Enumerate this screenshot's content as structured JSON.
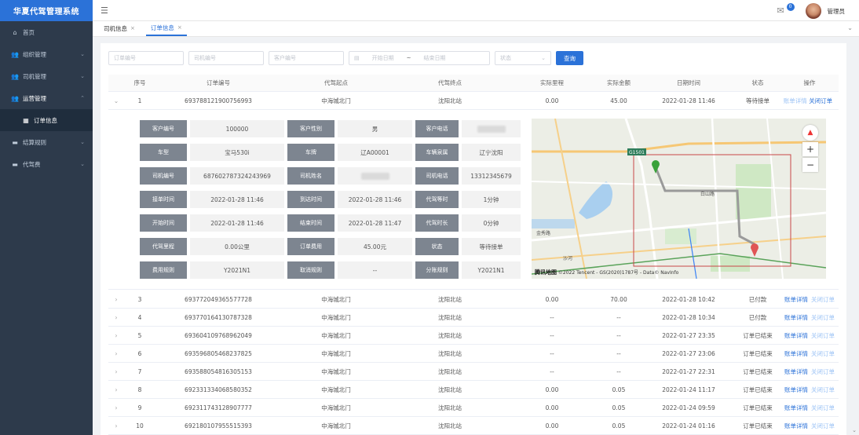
{
  "app": {
    "title": "华夏代驾管理系统"
  },
  "sidebar": {
    "items": [
      {
        "label": "首页",
        "icon": "home-icon"
      },
      {
        "label": "组织管理",
        "icon": "users-icon"
      },
      {
        "label": "司机管理",
        "icon": "users-icon"
      },
      {
        "label": "运营管理",
        "icon": "users-icon"
      },
      {
        "label": "订单信息",
        "icon": "building-icon"
      },
      {
        "label": "结算规则",
        "icon": "card-icon"
      },
      {
        "label": "代驾费",
        "icon": "card-icon"
      }
    ]
  },
  "header": {
    "badge": "0",
    "username": "管理员"
  },
  "tabs": [
    {
      "label": "司机信息"
    },
    {
      "label": "订单信息"
    }
  ],
  "filters": {
    "order_no": "订单编号",
    "driver_no": "司机编号",
    "customer_no": "客户编号",
    "start_date": "开始日期",
    "end_date": "结束日期",
    "status": "状态",
    "query": "查询"
  },
  "table": {
    "headers": [
      "序号",
      "订单编号",
      "代驾起点",
      "代驾终点",
      "实际里程",
      "实际金额",
      "日期时间",
      "状态",
      "操作"
    ],
    "action_detail": "账单详情",
    "action_close": "关闭订单",
    "expanded_row": {
      "seq": "1",
      "order_no": "693788121900756993",
      "from": "中海城北门",
      "to": "沈阳北站",
      "mileage": "0.00",
      "amount": "45.00",
      "datetime": "2022-01-28 11:46",
      "status": "等待接单"
    },
    "rows": [
      {
        "seq": "3",
        "order_no": "693772049365577728",
        "from": "中海城北门",
        "to": "沈阳北站",
        "mileage": "0.00",
        "amount": "70.00",
        "datetime": "2022-01-28 10:42",
        "status": "已付款"
      },
      {
        "seq": "4",
        "order_no": "693770164130787328",
        "from": "中海城北门",
        "to": "沈阳北站",
        "mileage": "--",
        "amount": "--",
        "datetime": "2022-01-28 10:34",
        "status": "已付款"
      },
      {
        "seq": "5",
        "order_no": "693604109768962049",
        "from": "中海城北门",
        "to": "沈阳北站",
        "mileage": "--",
        "amount": "--",
        "datetime": "2022-01-27 23:35",
        "status": "订单已结束"
      },
      {
        "seq": "6",
        "order_no": "693596805468237825",
        "from": "中海城北门",
        "to": "沈阳北站",
        "mileage": "--",
        "amount": "--",
        "datetime": "2022-01-27 23:06",
        "status": "订单已结束"
      },
      {
        "seq": "7",
        "order_no": "693588054816305153",
        "from": "中海城北门",
        "to": "沈阳北站",
        "mileage": "--",
        "amount": "--",
        "datetime": "2022-01-27 22:31",
        "status": "订单已结束"
      },
      {
        "seq": "8",
        "order_no": "692331334068580352",
        "from": "中海城北门",
        "to": "沈阳北站",
        "mileage": "0.00",
        "amount": "0.05",
        "datetime": "2022-01-24 11:17",
        "status": "订单已结束"
      },
      {
        "seq": "9",
        "order_no": "692311743128907777",
        "from": "中海城北门",
        "to": "沈阳北站",
        "mileage": "0.00",
        "amount": "0.05",
        "datetime": "2022-01-24 09:59",
        "status": "订单已结束"
      },
      {
        "seq": "10",
        "order_no": "692180107955515393",
        "from": "中海城北门",
        "to": "沈阳北站",
        "mileage": "0.00",
        "amount": "0.05",
        "datetime": "2022-01-24 01:16",
        "status": "订单已结束"
      }
    ]
  },
  "detail": {
    "cells": [
      {
        "label": "客户编号",
        "value": "100000"
      },
      {
        "label": "客户性别",
        "value": "男"
      },
      {
        "label": "客户电话",
        "value": ""
      },
      {
        "label": "车型",
        "value": "宝马530i"
      },
      {
        "label": "车牌",
        "value": "辽A00001"
      },
      {
        "label": "车辆泉属",
        "value": "辽宁沈阳"
      },
      {
        "label": "司机编号",
        "value": "687602787324243969"
      },
      {
        "label": "司机姓名",
        "value": ""
      },
      {
        "label": "司机电话",
        "value": "13312345679"
      },
      {
        "label": "接单时间",
        "value": "2022-01-28 11:46"
      },
      {
        "label": "到达时间",
        "value": "2022-01-28 11:46"
      },
      {
        "label": "代驾等时",
        "value": "1分钟"
      },
      {
        "label": "开始时间",
        "value": "2022-01-28 11:46"
      },
      {
        "label": "结束时间",
        "value": "2022-01-28 11:47"
      },
      {
        "label": "代驾时长",
        "value": "0分钟"
      },
      {
        "label": "代驾里程",
        "value": "0.00公里"
      },
      {
        "label": "订单费用",
        "value": "45.00元"
      },
      {
        "label": "状态",
        "value": "等待接单"
      },
      {
        "label": "费用规则",
        "value": "Y2021N1"
      },
      {
        "label": "取消规则",
        "value": "--"
      },
      {
        "label": "分账规则",
        "value": "Y2021N1"
      }
    ],
    "map": {
      "logo": "腾讯地图",
      "copyright": "©2022 Tencent - GS(2020)1787号 - Data© NavInfo",
      "labels": {
        "highway": "G1501",
        "road": "白山路",
        "district": "金秀路",
        "station": "沙河"
      }
    }
  }
}
